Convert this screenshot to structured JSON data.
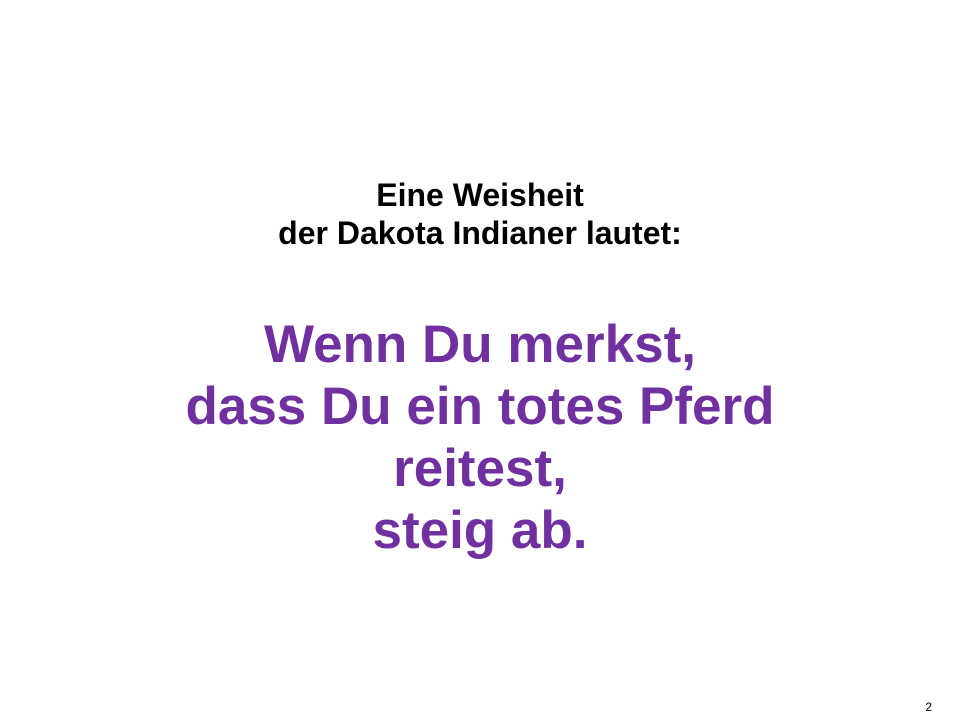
{
  "slide": {
    "intro_lines": [
      "Eine Weisheit",
      "der Dakota Indianer lautet:"
    ],
    "quote_lines": [
      "Wenn Du merkst,",
      "dass Du ein totes Pferd",
      "reitest,",
      "steig ab."
    ],
    "page_number": "2"
  },
  "colors": {
    "background": "#ffffff",
    "intro_text": "#000000",
    "quote_text": "#7030a0"
  }
}
